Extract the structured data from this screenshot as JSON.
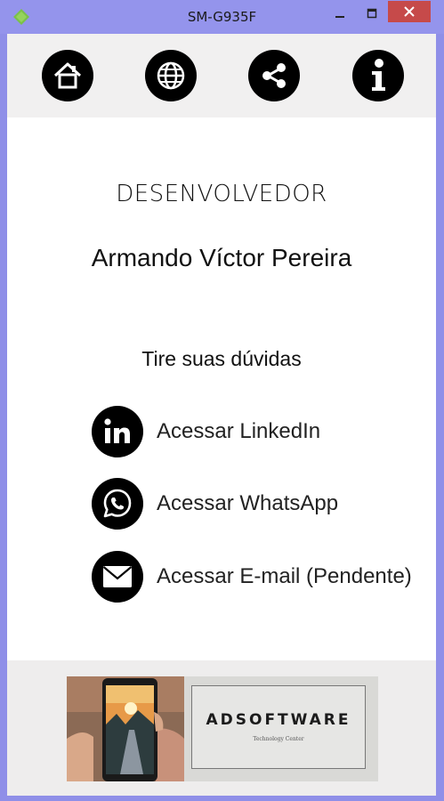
{
  "window": {
    "title": "SM-G935F",
    "controls": [
      "minimize-icon",
      "maximize-icon",
      "close-icon"
    ]
  },
  "nav": {
    "items": [
      {
        "icon": "home-icon"
      },
      {
        "icon": "globe-icon"
      },
      {
        "icon": "share-icon"
      },
      {
        "icon": "info-icon"
      }
    ]
  },
  "developer": {
    "role": "DESENVOLVEDOR",
    "name": "Armando Víctor Pereira"
  },
  "contact": {
    "heading": "Tire suas dúvidas",
    "links": [
      {
        "icon": "linkedin-icon",
        "label": "Acessar LinkedIn"
      },
      {
        "icon": "whatsapp-icon",
        "label": "Acessar WhatsApp"
      },
      {
        "icon": "email-icon",
        "label": "Acessar E-mail (Pendente)"
      }
    ]
  },
  "banner": {
    "brand": "ADSOFTWARE",
    "tagline": "Technology Center"
  },
  "colors": {
    "titlebar": "#9494ec",
    "close_button": "#c64a4a",
    "icon_background": "#000000",
    "nav_background": "#f1f0f0",
    "footer_background": "#eeeded"
  }
}
